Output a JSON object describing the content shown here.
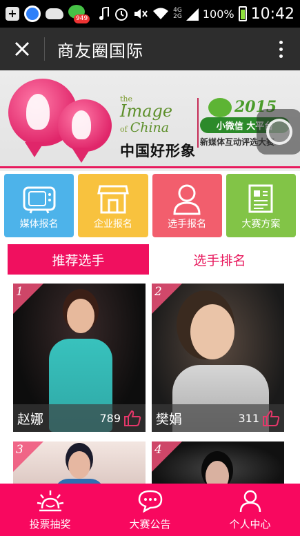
{
  "status_bar": {
    "wechat_badge": "949",
    "signal_top": "4G",
    "signal_bottom": "2G",
    "battery": "100%",
    "time": "10:42"
  },
  "title_bar": {
    "title": "商友圈国际"
  },
  "banner": {
    "logo_the": "the",
    "logo_image": "Image",
    "logo_of": "of",
    "logo_china": "China",
    "logo_cn": "中国好形象",
    "award_year": "2015",
    "award_pill": "小微信 大平台",
    "award_sub": "新媒体互动评选大赛"
  },
  "tiles": [
    {
      "label": "媒体报名",
      "icon": "tv-icon",
      "color": "#4db3ea"
    },
    {
      "label": "企业报名",
      "icon": "store-icon",
      "color": "#f8c23e"
    },
    {
      "label": "选手报名",
      "icon": "person-icon",
      "color": "#f25e6d"
    },
    {
      "label": "大赛方案",
      "icon": "newspaper-icon",
      "color": "#82c447"
    }
  ],
  "tabs": [
    {
      "label": "推荐选手",
      "active": true
    },
    {
      "label": "选手排名",
      "active": false
    }
  ],
  "contestants": [
    {
      "rank": "1",
      "name": "赵娜",
      "votes": "789"
    },
    {
      "rank": "2",
      "name": "樊娟",
      "votes": "311"
    },
    {
      "rank": "3"
    },
    {
      "rank": "4"
    }
  ],
  "bottom_nav": [
    {
      "label": "投票抽奖",
      "icon": "sun-icon"
    },
    {
      "label": "大赛公告",
      "icon": "chat-icon"
    },
    {
      "label": "个人中心",
      "icon": "user-icon"
    }
  ],
  "colors": {
    "accent": "#f0105f",
    "title_bar": "#2d2d2d"
  }
}
